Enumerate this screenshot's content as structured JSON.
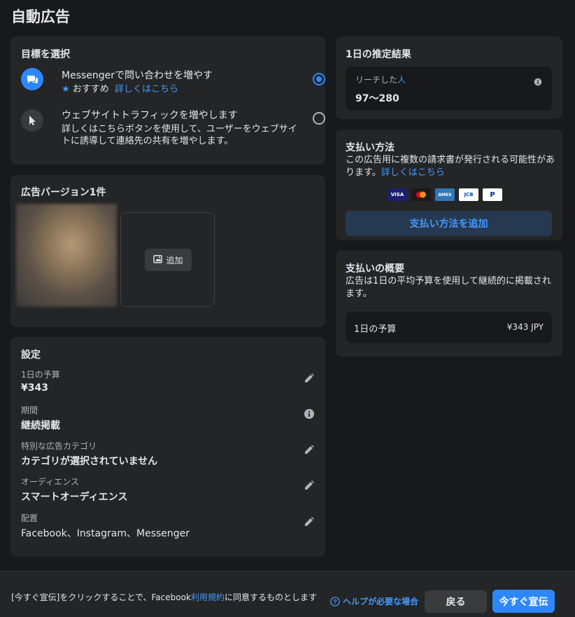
{
  "page": {
    "title": "自動広告"
  },
  "objective": {
    "title": "目標を選択",
    "options": [
      {
        "title": "Messengerで問い合わせを増やす",
        "recommended": "おすすめ",
        "learn_more": "詳しくはこちら",
        "selected": true,
        "icon": "messenger-chat-icon"
      },
      {
        "title": "ウェブサイトトラフィックを増やします",
        "description": "詳しくはこちらボタンを使用して、ユーザーをウェブサイトに誘導して連絡先の共有を増やします。",
        "selected": false,
        "icon": "cursor-icon"
      }
    ]
  },
  "versions": {
    "title": "広告バージョン1件",
    "add_label": "追加"
  },
  "settings": {
    "title": "設定",
    "rows": [
      {
        "label": "1日の予算",
        "value": "¥343",
        "icon": "pencil-icon"
      },
      {
        "label": "期間",
        "value": "継続掲載",
        "icon": "info-icon"
      },
      {
        "label": "特別な広告カテゴリ",
        "value": "カテゴリが選択されていません",
        "icon": "pencil-icon"
      },
      {
        "label": "オーディエンス",
        "value": "スマートオーディエンス",
        "icon": "pencil-icon"
      },
      {
        "label": "配置",
        "value": "Facebook、Instagram、Messenger",
        "icon": "pencil-icon"
      }
    ]
  },
  "estimate": {
    "title": "1日の推定結果",
    "reach_label_prefix": "リーチした",
    "reach_label_link": "人",
    "reach_value": "97〜280"
  },
  "payment": {
    "title": "支払い方法",
    "description": "この広告用に複数の請求書が発行される可能性があります。",
    "learn_more": "詳しくはこちら",
    "card_brands": [
      "VISA",
      "Mastercard",
      "AMEX",
      "JCB",
      "PayPal"
    ],
    "add_button": "支払い方法を追加"
  },
  "summary": {
    "title": "支払いの概要",
    "description": "広告は1日の平均予算を使用して継続的に掲載されます。",
    "budget_label": "1日の予算",
    "budget_value": "¥343 JPY"
  },
  "footer": {
    "note_prefix": "[今すぐ宣伝]をクリックすることで、Facebook",
    "note_link": "利用規約",
    "note_suffix": "に同意するものとします",
    "help": "ヘルプが必要な場合",
    "back": "戻る",
    "promote": "今すぐ宣伝"
  },
  "colors": {
    "accent": "#2d88ff",
    "card": "#242526",
    "background": "#18191a"
  }
}
